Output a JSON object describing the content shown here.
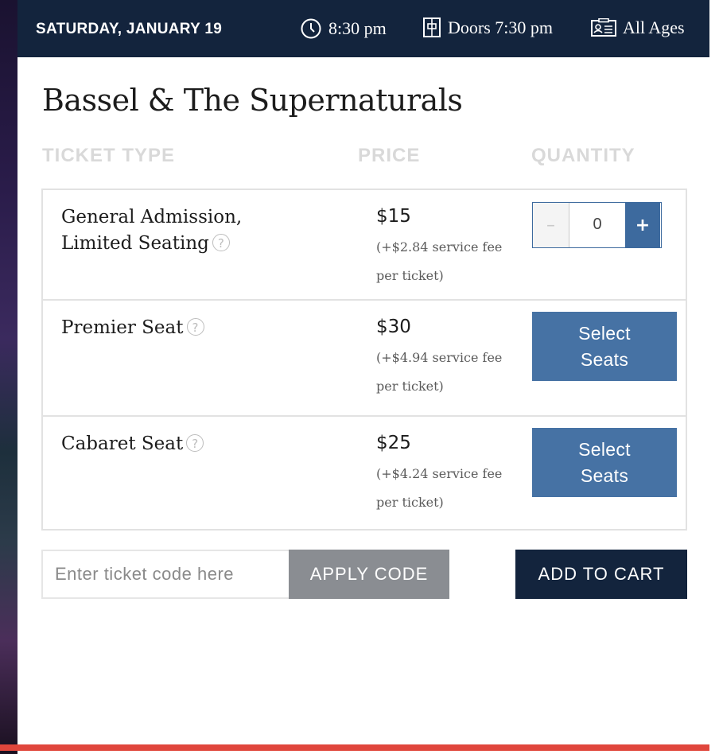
{
  "header": {
    "date": "SATURDAY, JANUARY 19",
    "time": "8:30 pm",
    "doors": "Doors 7:30 pm",
    "ages": "All Ages",
    "icons": [
      "clock-icon",
      "door-icon",
      "id-card-icon"
    ]
  },
  "event": {
    "title": "Bassel & The Supernaturals"
  },
  "columns": {
    "type": "TICKET TYPE",
    "price": "PRICE",
    "quantity": "QUANTITY"
  },
  "tickets": [
    {
      "name": "General Admission, Limited Seating",
      "price": "$15",
      "fee": "(+$2.84 service fee per ticket)",
      "quantity": "0",
      "minus": "–",
      "plus": "+"
    },
    {
      "name": "Premier Seat",
      "price": "$30",
      "fee": "(+$4.94 service fee per ticket)",
      "button": "Select\nSeats"
    },
    {
      "name": "Cabaret Seat",
      "price": "$25",
      "fee": "(+$4.24 service fee per ticket)",
      "button": "Select\nSeats"
    }
  ],
  "help_glyph": "?",
  "footer": {
    "code_placeholder": "Enter ticket code here",
    "apply_label": "APPLY CODE",
    "cart_label": "ADD TO CART"
  },
  "colors": {
    "navy": "#13243d",
    "blue": "#4672a4",
    "gray_button": "#8a8d92",
    "accent_red": "#e0463c"
  }
}
